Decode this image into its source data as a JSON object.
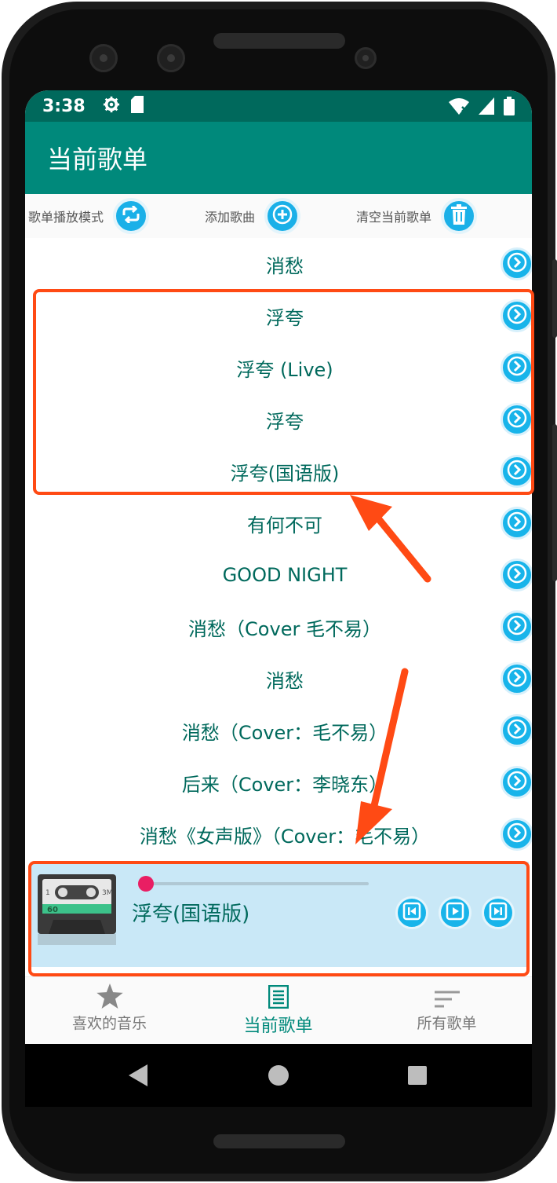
{
  "statusbar": {
    "time": "3:38"
  },
  "toolbar": {
    "title": "当前歌单"
  },
  "actions": {
    "play_mode_label": "歌单播放模式",
    "add_song_label": "添加歌曲",
    "clear_label": "清空当前歌单"
  },
  "songs": [
    {
      "title": "消愁"
    },
    {
      "title": "浮夸"
    },
    {
      "title": "浮夸 (Live)"
    },
    {
      "title": "浮夸"
    },
    {
      "title": "浮夸(国语版)"
    },
    {
      "title": "有何不可"
    },
    {
      "title": "GOOD NIGHT"
    },
    {
      "title": "消愁（Cover 毛不易）"
    },
    {
      "title": "消愁"
    },
    {
      "title": "消愁（Cover：毛不易）"
    },
    {
      "title": "后来（Cover：李晓东）"
    },
    {
      "title": "消愁《女声版》（Cover：毛不易）"
    }
  ],
  "player": {
    "now_playing": "浮夸(国语版)",
    "progress": 0.0,
    "cassette_label_left": "1",
    "cassette_label_right": "3M",
    "cassette_tape": "60"
  },
  "bottom_nav": {
    "favorites_label": "喜欢的音乐",
    "current_label": "当前歌单",
    "all_label": "所有歌单",
    "active": "current"
  },
  "colors": {
    "statusbar": "#00695c",
    "toolbar": "#00897b",
    "accent_button": "#1ab0e8",
    "song_text": "#00695c",
    "player_bg": "#c9e8f7",
    "thumb": "#e91e63",
    "annotation": "#ff4a14"
  }
}
